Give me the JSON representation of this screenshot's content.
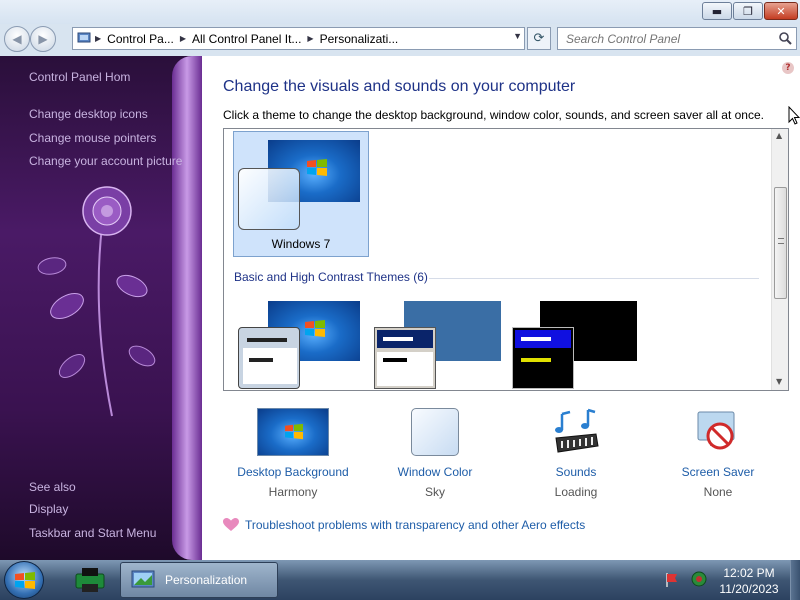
{
  "window": {
    "controls": {
      "minimize": "▬",
      "maximize": "❐",
      "close": "✕"
    }
  },
  "nav": {
    "back_glyph": "◀",
    "forward_glyph": "▶",
    "breadcrumbs": [
      "Control Pa...",
      "All Control Panel It...",
      "Personalizati..."
    ],
    "search_placeholder": "Search Control Panel"
  },
  "sidebar": {
    "home_link": "Control Panel Hom",
    "tasks": [
      "Change desktop icons",
      "Change mouse pointers",
      "Change your account picture"
    ],
    "see_also_title": "See also",
    "see_also": [
      "Display",
      "Taskbar and Start Menu"
    ]
  },
  "main": {
    "help_glyph": "?",
    "title": "Change the visuals and sounds on your computer",
    "subtitle": "Click a theme to change the desktop background, window color, sounds, and screen saver all at once.",
    "themes": {
      "selected_theme": "Windows 7",
      "basic_group_label": "Basic and High Contrast Themes (6)"
    },
    "tiles": [
      {
        "name": "Desktop Background",
        "value": "Harmony"
      },
      {
        "name": "Window Color",
        "value": "Sky"
      },
      {
        "name": "Sounds",
        "value": "Loading"
      },
      {
        "name": "Screen Saver",
        "value": "None"
      }
    ],
    "troubleshoot_link": "Troubleshoot problems with transparency and other Aero effects"
  },
  "taskbar": {
    "active_task": "Personalization",
    "clock_time": "12:02 PM",
    "clock_date": "11/20/2023"
  },
  "colors": {
    "title_blue": "#1e3287",
    "link_blue": "#1e5da8",
    "sidebar_purple": "#4a1a66",
    "selection": "#cfe3fb"
  }
}
